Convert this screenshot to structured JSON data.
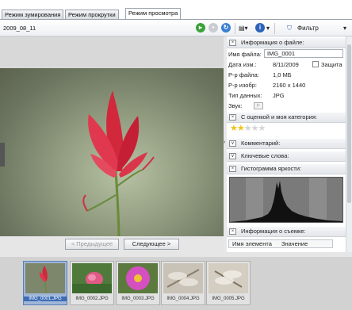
{
  "tabs": [
    {
      "label": "Режим зумирования"
    },
    {
      "label": "Режим прокрутки"
    },
    {
      "label": "Режим просмотра"
    }
  ],
  "toolbar": {
    "folder": "2009_08_11",
    "filter_label": "Фильтр"
  },
  "nav": {
    "prev_label": "< Предыдущее",
    "next_label": "Следующее >"
  },
  "info_panel": {
    "file_info": {
      "header": "Информация о файле:",
      "name_label": "Имя файла:",
      "name_value": "IMG_0001",
      "date_label": "Дата изм.:",
      "date_value": "8/11/2009",
      "protect_label": "Защита",
      "size_label": "Р-р файла:",
      "size_value": "1,0 МБ",
      "dims_label": "Р-р изобр:",
      "dims_value": "2160 x 1440",
      "type_label": "Тип данных:",
      "type_value": "JPG",
      "sound_label": "Звук:"
    },
    "rating_header": "С оценкой и моя категория:",
    "rating": {
      "value": 2,
      "max": 5
    },
    "comment_header": "Комментарий:",
    "keywords_header": "Ключевые слова:",
    "histogram_header": "Гистограмма яркости:",
    "shooting_header": "Информация о съемке:",
    "shooting_columns": [
      "Имя элемента",
      "Значение"
    ]
  },
  "filmstrip": [
    {
      "caption": "IMG_0001.JPG",
      "selected": true
    },
    {
      "caption": "IMG_0002.JPG",
      "selected": false
    },
    {
      "caption": "IMG_0003.JPG",
      "selected": false
    },
    {
      "caption": "IMG_0004.JPG",
      "selected": false
    },
    {
      "caption": "IMG_0005.JPG",
      "selected": false
    }
  ],
  "colors": {
    "accent_selection": "#3d6db5",
    "star_on": "#f2c318"
  }
}
